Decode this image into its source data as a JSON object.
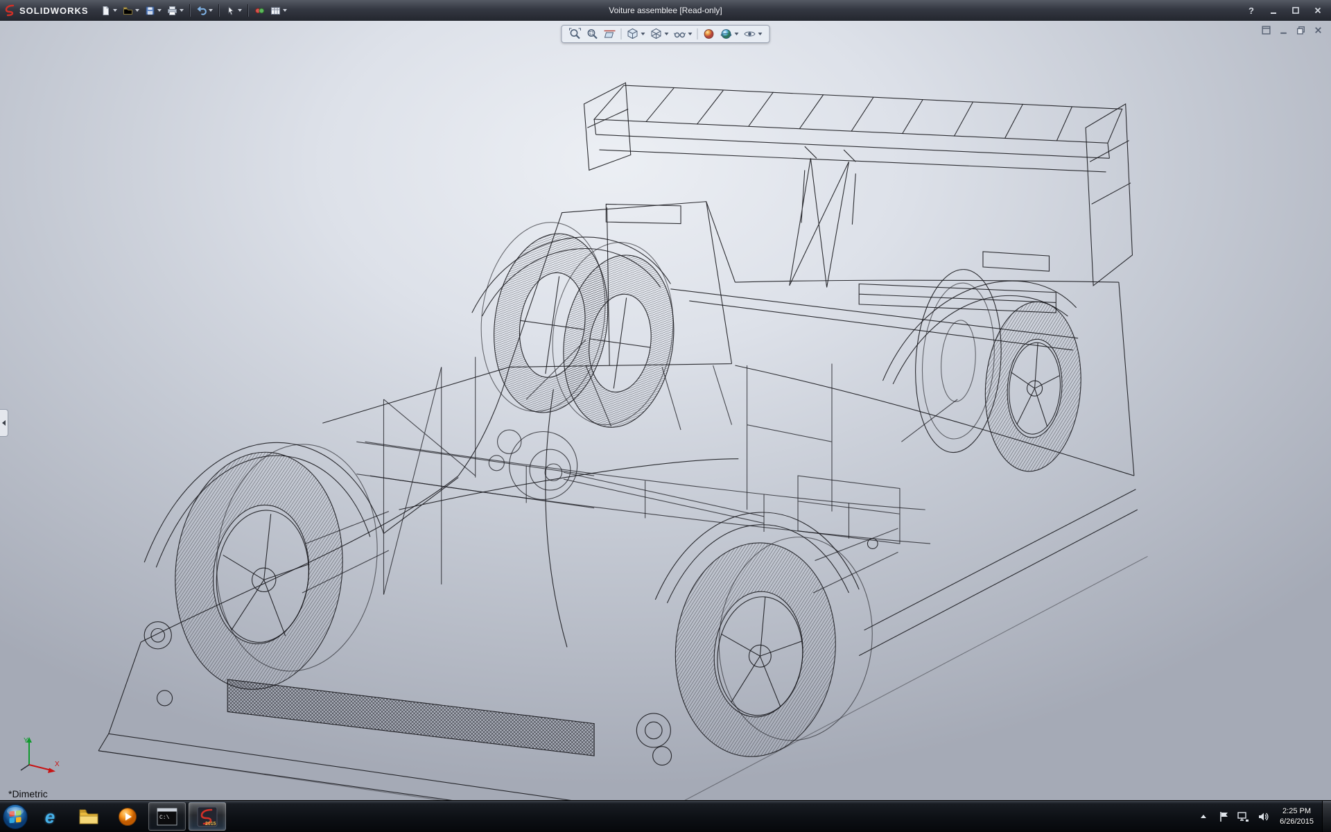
{
  "titlebar": {
    "app_name": "SOLIDWORKS",
    "document_title": "Voiture assemblee [Read-only]",
    "help_label": "?",
    "tools": [
      "new-document",
      "open",
      "save",
      "print",
      "undo",
      "select",
      "appearance-swatch",
      "sheet-properties"
    ],
    "window_controls": [
      "minimize",
      "maximize",
      "close"
    ]
  },
  "view_toolbar": {
    "icons": [
      "zoom-to-fit",
      "zoom-to-area",
      "section-view",
      "view-orientation",
      "display-style",
      "hide-show-items",
      "edit-appearance",
      "apply-scene",
      "view-settings"
    ]
  },
  "document_controls": [
    "new-window",
    "minimize",
    "restore",
    "close"
  ],
  "viewport": {
    "orientation_label": "*Dimetric",
    "triad": {
      "x": "X",
      "y": "Y"
    }
  },
  "taskbar": {
    "items": [
      {
        "name": "start"
      },
      {
        "name": "internet-explorer",
        "glyph": "e"
      },
      {
        "name": "windows-explorer"
      },
      {
        "name": "windows-media-player"
      },
      {
        "name": "command-prompt",
        "glyph": "C:\\",
        "running": true
      },
      {
        "name": "solidworks-2015",
        "badge": "2015",
        "running": true,
        "active": true
      }
    ],
    "tray": {
      "time": "2:25 PM",
      "date": "6/26/2015",
      "icons": [
        "show-hidden-icons",
        "action-center",
        "network",
        "volume"
      ]
    }
  },
  "colors": {
    "viewport_top": "#ecEFf4",
    "viewport_bottom": "#a5aab6",
    "wireframe": "#17171c",
    "titlebar_bg": "#343842",
    "accent_red": "#cf2a27"
  }
}
